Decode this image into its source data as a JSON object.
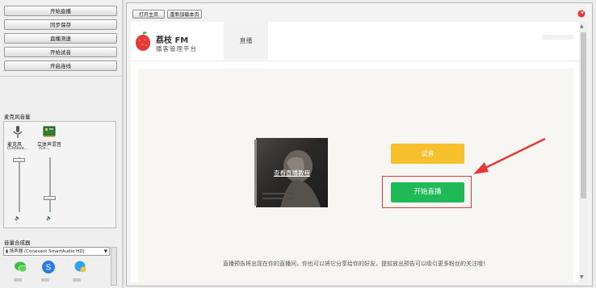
{
  "left_panel": {
    "buttons": [
      "开始直播",
      "同步保存",
      "直播测速",
      "开始试音",
      "开启连线"
    ],
    "mic_section_label": "麦克风音量",
    "devices": [
      {
        "name": "麦克风",
        "sub": "(Conexa…"
      },
      {
        "name": "立体声混音",
        "sub": "(Co…"
      }
    ],
    "mixer_label": "音量合成器",
    "output_device": "扬声器 (Conexant SmartAudio HD)",
    "mic_level": 0.05,
    "stereo_level": 0.8
  },
  "toolbar": {
    "open_home": "打开主页",
    "reload": "重新加载本页"
  },
  "site": {
    "logo_title": "荔枝 FM",
    "logo_subtitle": "播客管理平台",
    "nav_tab": "直播"
  },
  "content": {
    "video_label": "查看直播教程",
    "trial_button": "试音",
    "start_button": "开始直播",
    "footer_note": "直播预告将出现在你的直播间，你也可以将它分享给你的好友，提前放出预告可以吸引更多粉丝的关注哦！"
  },
  "colors": {
    "start_green": "#1fb957",
    "trial_yellow": "#f6c12c",
    "highlight_red": "#e53935"
  }
}
